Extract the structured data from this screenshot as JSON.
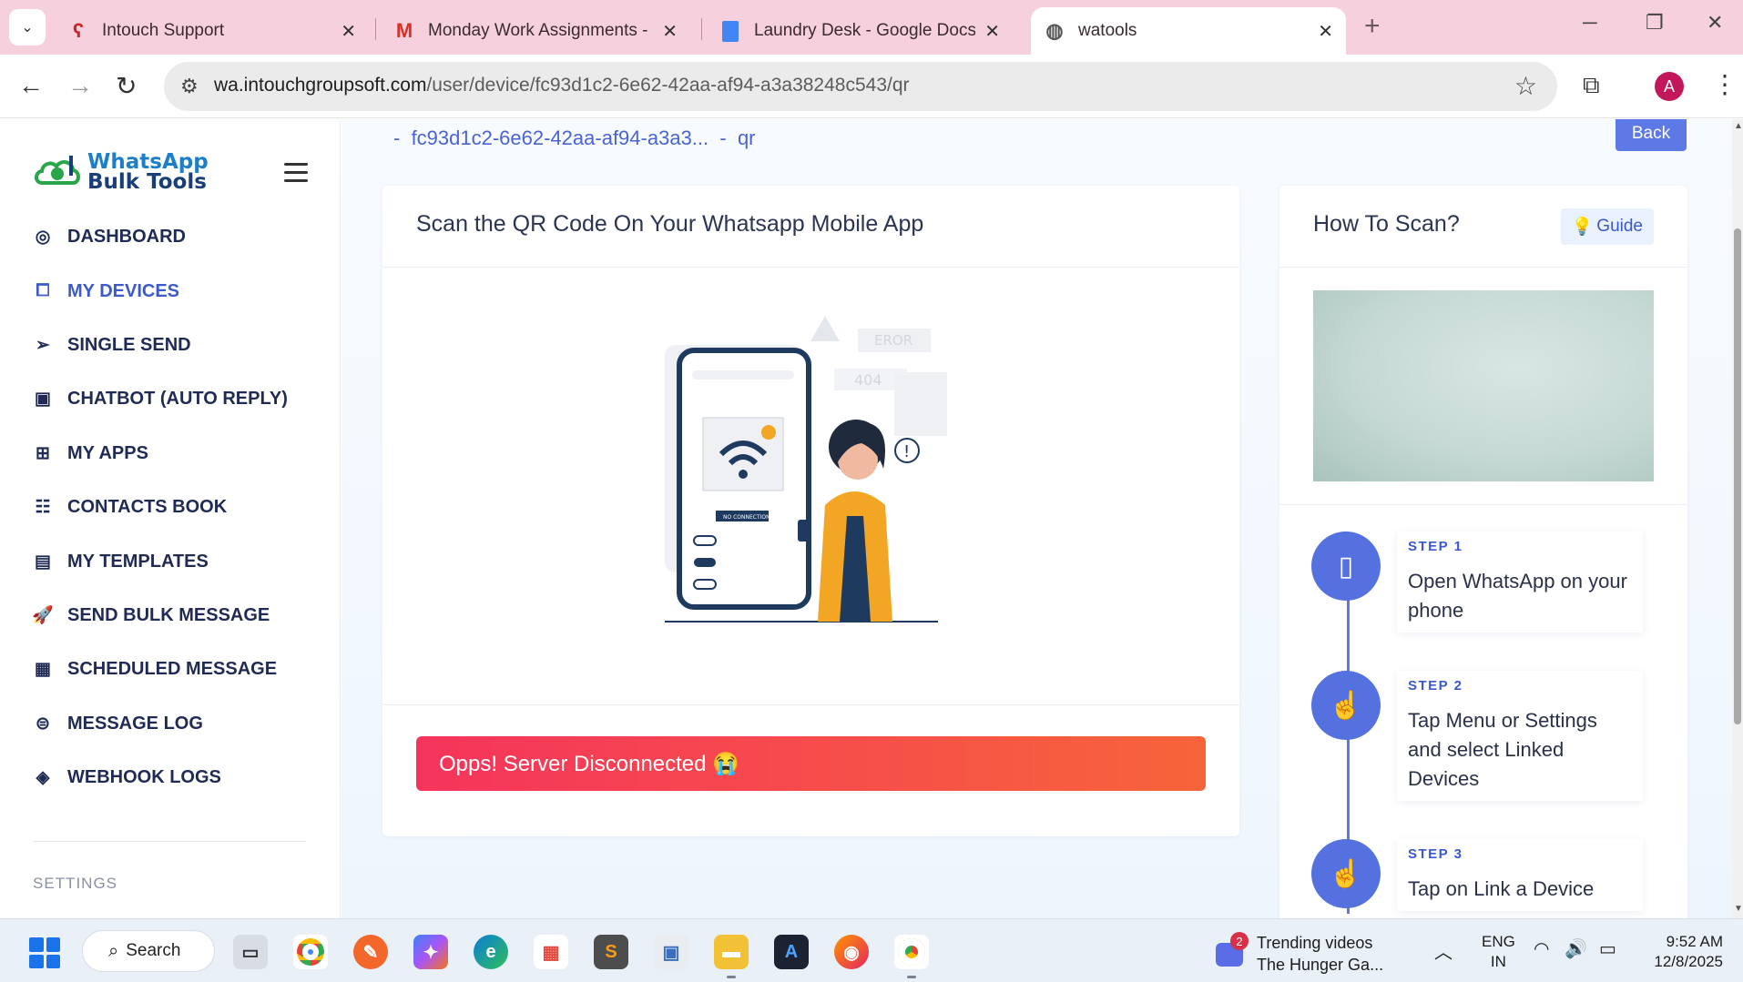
{
  "browser": {
    "tabs": [
      {
        "title": "Intouch Support",
        "active": false
      },
      {
        "title": "Monday Work Assignments - as",
        "active": false
      },
      {
        "title": "Laundry Desk - Google Docs",
        "active": false
      },
      {
        "title": "watools",
        "active": true
      }
    ],
    "url_host": "wa.intouchgroupsoft.com",
    "url_path": "/user/device/fc93d1c2-6e62-42aa-af94-a3a38248c543/qr",
    "profile_initial": "A"
  },
  "sidebar": {
    "logo_line1": "WhatsApp",
    "logo_line2": "Bulk Tools",
    "items": [
      {
        "label": "DASHBOARD",
        "icon": "dashboard-icon"
      },
      {
        "label": "MY DEVICES",
        "icon": "devices-icon"
      },
      {
        "label": "SINGLE SEND",
        "icon": "send-icon"
      },
      {
        "label": "CHATBOT (AUTO REPLY)",
        "icon": "robot-icon"
      },
      {
        "label": "MY APPS",
        "icon": "apps-icon"
      },
      {
        "label": "CONTACTS BOOK",
        "icon": "contacts-icon"
      },
      {
        "label": "MY TEMPLATES",
        "icon": "templates-icon"
      },
      {
        "label": "SEND BULK MESSAGE",
        "icon": "rocket-icon"
      },
      {
        "label": "SCHEDULED MESSAGE",
        "icon": "calendar-icon"
      },
      {
        "label": "MESSAGE LOG",
        "icon": "log-icon"
      },
      {
        "label": "WEBHOOK LOGS",
        "icon": "webhook-icon"
      }
    ],
    "settings_label": "SETTINGS"
  },
  "main": {
    "breadcrumb_sep1": "-",
    "breadcrumb_device": "fc93d1c2-6e62-42aa-af94-a3a3...",
    "breadcrumb_sep2": "-",
    "breadcrumb_page": "qr",
    "back_label": "Back",
    "qr_card_title": "Scan the QR Code On Your Whatsapp Mobile App",
    "alert_text": "Opps! Server Disconnected 😭",
    "illustration": {
      "error_label": "EROR",
      "code_label": "404",
      "status_label": "NO CONNECTION"
    },
    "scan_card_title": "How To Scan?",
    "guide_label": "Guide",
    "steps": [
      {
        "num": "STEP 1",
        "text": "Open WhatsApp on your phone",
        "icon": "phone-icon"
      },
      {
        "num": "STEP 2",
        "text": "Tap Menu or Settings and select Linked Devices",
        "icon": "tap-icon"
      },
      {
        "num": "STEP 3",
        "text": "Tap on Link a Device",
        "icon": "tap-icon"
      }
    ]
  },
  "taskbar": {
    "search_label": "Search",
    "news_badge": "2",
    "news_title": "Trending videos",
    "news_sub": "The Hunger Ga...",
    "lang1": "ENG",
    "lang2": "IN",
    "time": "9:52 AM",
    "date": "12/8/2025"
  },
  "colors": {
    "accent": "#3c5acb",
    "alert_start": "#f5345c",
    "alert_end": "#f7643a",
    "tabstrip": "#f6d1dd"
  }
}
